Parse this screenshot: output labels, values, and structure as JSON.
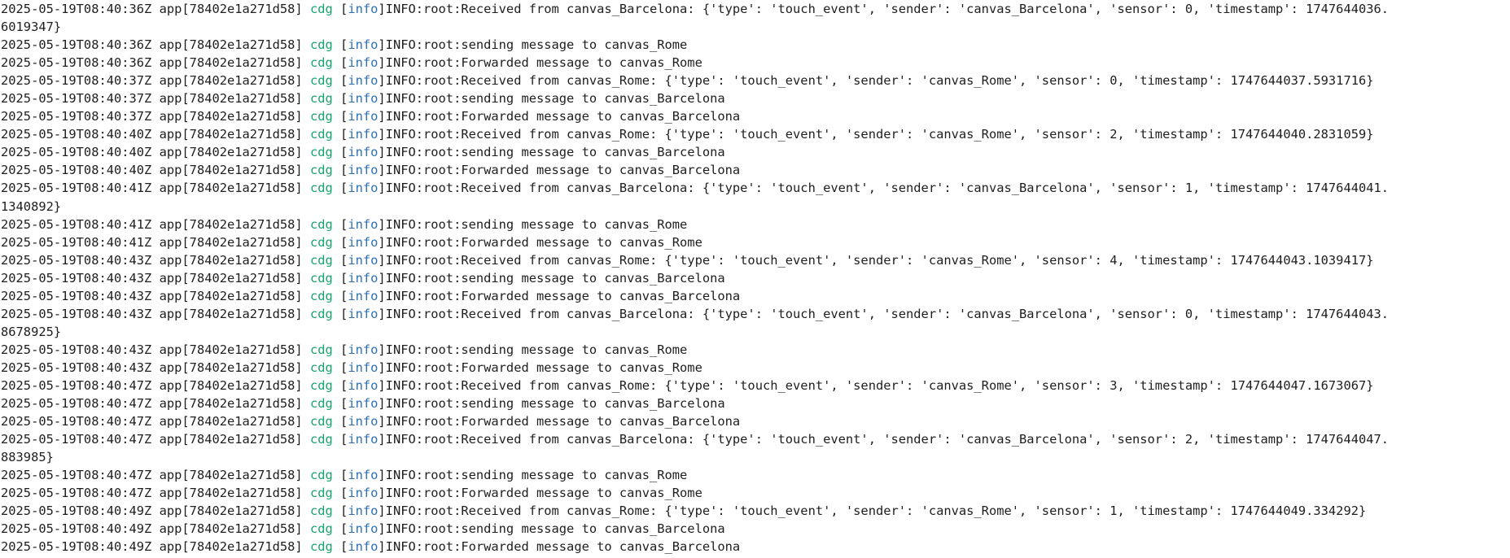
{
  "colors": {
    "background": "#ffffff",
    "text": "#1e1e1e",
    "cdg": "#17a36d",
    "info": "#2b6fb8"
  },
  "lines": [
    {
      "time": "2025-05-19T08:40:36Z",
      "app": "app[78402e1a271d58]",
      "cdg": "cdg",
      "level": "info",
      "msg": "INFO:root:Received from canvas_Barcelona: {'type': 'touch_event', 'sender': 'canvas_Barcelona', 'sensor': 0, 'timestamp': 1747644036.",
      "cont": "6019347}"
    },
    {
      "time": "2025-05-19T08:40:36Z",
      "app": "app[78402e1a271d58]",
      "cdg": "cdg",
      "level": "info",
      "msg": "INFO:root:sending message to canvas_Rome",
      "cont": ""
    },
    {
      "time": "2025-05-19T08:40:36Z",
      "app": "app[78402e1a271d58]",
      "cdg": "cdg",
      "level": "info",
      "msg": "INFO:root:Forwarded message to canvas_Rome",
      "cont": ""
    },
    {
      "time": "2025-05-19T08:40:37Z",
      "app": "app[78402e1a271d58]",
      "cdg": "cdg",
      "level": "info",
      "msg": "INFO:root:Received from canvas_Rome: {'type': 'touch_event', 'sender': 'canvas_Rome', 'sensor': 0, 'timestamp': 1747644037.5931716}",
      "cont": ""
    },
    {
      "time": "2025-05-19T08:40:37Z",
      "app": "app[78402e1a271d58]",
      "cdg": "cdg",
      "level": "info",
      "msg": "INFO:root:sending message to canvas_Barcelona",
      "cont": ""
    },
    {
      "time": "2025-05-19T08:40:37Z",
      "app": "app[78402e1a271d58]",
      "cdg": "cdg",
      "level": "info",
      "msg": "INFO:root:Forwarded message to canvas_Barcelona",
      "cont": ""
    },
    {
      "time": "2025-05-19T08:40:40Z",
      "app": "app[78402e1a271d58]",
      "cdg": "cdg",
      "level": "info",
      "msg": "INFO:root:Received from canvas_Rome: {'type': 'touch_event', 'sender': 'canvas_Rome', 'sensor': 2, 'timestamp': 1747644040.2831059}",
      "cont": ""
    },
    {
      "time": "2025-05-19T08:40:40Z",
      "app": "app[78402e1a271d58]",
      "cdg": "cdg",
      "level": "info",
      "msg": "INFO:root:sending message to canvas_Barcelona",
      "cont": ""
    },
    {
      "time": "2025-05-19T08:40:40Z",
      "app": "app[78402e1a271d58]",
      "cdg": "cdg",
      "level": "info",
      "msg": "INFO:root:Forwarded message to canvas_Barcelona",
      "cont": ""
    },
    {
      "time": "2025-05-19T08:40:41Z",
      "app": "app[78402e1a271d58]",
      "cdg": "cdg",
      "level": "info",
      "msg": "INFO:root:Received from canvas_Barcelona: {'type': 'touch_event', 'sender': 'canvas_Barcelona', 'sensor': 1, 'timestamp': 1747644041.",
      "cont": "1340892}"
    },
    {
      "time": "2025-05-19T08:40:41Z",
      "app": "app[78402e1a271d58]",
      "cdg": "cdg",
      "level": "info",
      "msg": "INFO:root:sending message to canvas_Rome",
      "cont": ""
    },
    {
      "time": "2025-05-19T08:40:41Z",
      "app": "app[78402e1a271d58]",
      "cdg": "cdg",
      "level": "info",
      "msg": "INFO:root:Forwarded message to canvas_Rome",
      "cont": ""
    },
    {
      "time": "2025-05-19T08:40:43Z",
      "app": "app[78402e1a271d58]",
      "cdg": "cdg",
      "level": "info",
      "msg": "INFO:root:Received from canvas_Rome: {'type': 'touch_event', 'sender': 'canvas_Rome', 'sensor': 4, 'timestamp': 1747644043.1039417}",
      "cont": ""
    },
    {
      "time": "2025-05-19T08:40:43Z",
      "app": "app[78402e1a271d58]",
      "cdg": "cdg",
      "level": "info",
      "msg": "INFO:root:sending message to canvas_Barcelona",
      "cont": ""
    },
    {
      "time": "2025-05-19T08:40:43Z",
      "app": "app[78402e1a271d58]",
      "cdg": "cdg",
      "level": "info",
      "msg": "INFO:root:Forwarded message to canvas_Barcelona",
      "cont": ""
    },
    {
      "time": "2025-05-19T08:40:43Z",
      "app": "app[78402e1a271d58]",
      "cdg": "cdg",
      "level": "info",
      "msg": "INFO:root:Received from canvas_Barcelona: {'type': 'touch_event', 'sender': 'canvas_Barcelona', 'sensor': 0, 'timestamp': 1747644043.",
      "cont": "8678925}"
    },
    {
      "time": "2025-05-19T08:40:43Z",
      "app": "app[78402e1a271d58]",
      "cdg": "cdg",
      "level": "info",
      "msg": "INFO:root:sending message to canvas_Rome",
      "cont": ""
    },
    {
      "time": "2025-05-19T08:40:43Z",
      "app": "app[78402e1a271d58]",
      "cdg": "cdg",
      "level": "info",
      "msg": "INFO:root:Forwarded message to canvas_Rome",
      "cont": ""
    },
    {
      "time": "2025-05-19T08:40:47Z",
      "app": "app[78402e1a271d58]",
      "cdg": "cdg",
      "level": "info",
      "msg": "INFO:root:Received from canvas_Rome: {'type': 'touch_event', 'sender': 'canvas_Rome', 'sensor': 3, 'timestamp': 1747644047.1673067}",
      "cont": ""
    },
    {
      "time": "2025-05-19T08:40:47Z",
      "app": "app[78402e1a271d58]",
      "cdg": "cdg",
      "level": "info",
      "msg": "INFO:root:sending message to canvas_Barcelona",
      "cont": ""
    },
    {
      "time": "2025-05-19T08:40:47Z",
      "app": "app[78402e1a271d58]",
      "cdg": "cdg",
      "level": "info",
      "msg": "INFO:root:Forwarded message to canvas_Barcelona",
      "cont": ""
    },
    {
      "time": "2025-05-19T08:40:47Z",
      "app": "app[78402e1a271d58]",
      "cdg": "cdg",
      "level": "info",
      "msg": "INFO:root:Received from canvas_Barcelona: {'type': 'touch_event', 'sender': 'canvas_Barcelona', 'sensor': 2, 'timestamp': 1747644047.",
      "cont": "883985}"
    },
    {
      "time": "2025-05-19T08:40:47Z",
      "app": "app[78402e1a271d58]",
      "cdg": "cdg",
      "level": "info",
      "msg": "INFO:root:sending message to canvas_Rome",
      "cont": ""
    },
    {
      "time": "2025-05-19T08:40:47Z",
      "app": "app[78402e1a271d58]",
      "cdg": "cdg",
      "level": "info",
      "msg": "INFO:root:Forwarded message to canvas_Rome",
      "cont": ""
    },
    {
      "time": "2025-05-19T08:40:49Z",
      "app": "app[78402e1a271d58]",
      "cdg": "cdg",
      "level": "info",
      "msg": "INFO:root:Received from canvas_Rome: {'type': 'touch_event', 'sender': 'canvas_Rome', 'sensor': 1, 'timestamp': 1747644049.334292}",
      "cont": ""
    },
    {
      "time": "2025-05-19T08:40:49Z",
      "app": "app[78402e1a271d58]",
      "cdg": "cdg",
      "level": "info",
      "msg": "INFO:root:sending message to canvas_Barcelona",
      "cont": ""
    },
    {
      "time": "2025-05-19T08:40:49Z",
      "app": "app[78402e1a271d58]",
      "cdg": "cdg",
      "level": "info",
      "msg": "INFO:root:Forwarded message to canvas_Barcelona",
      "cont": ""
    }
  ]
}
